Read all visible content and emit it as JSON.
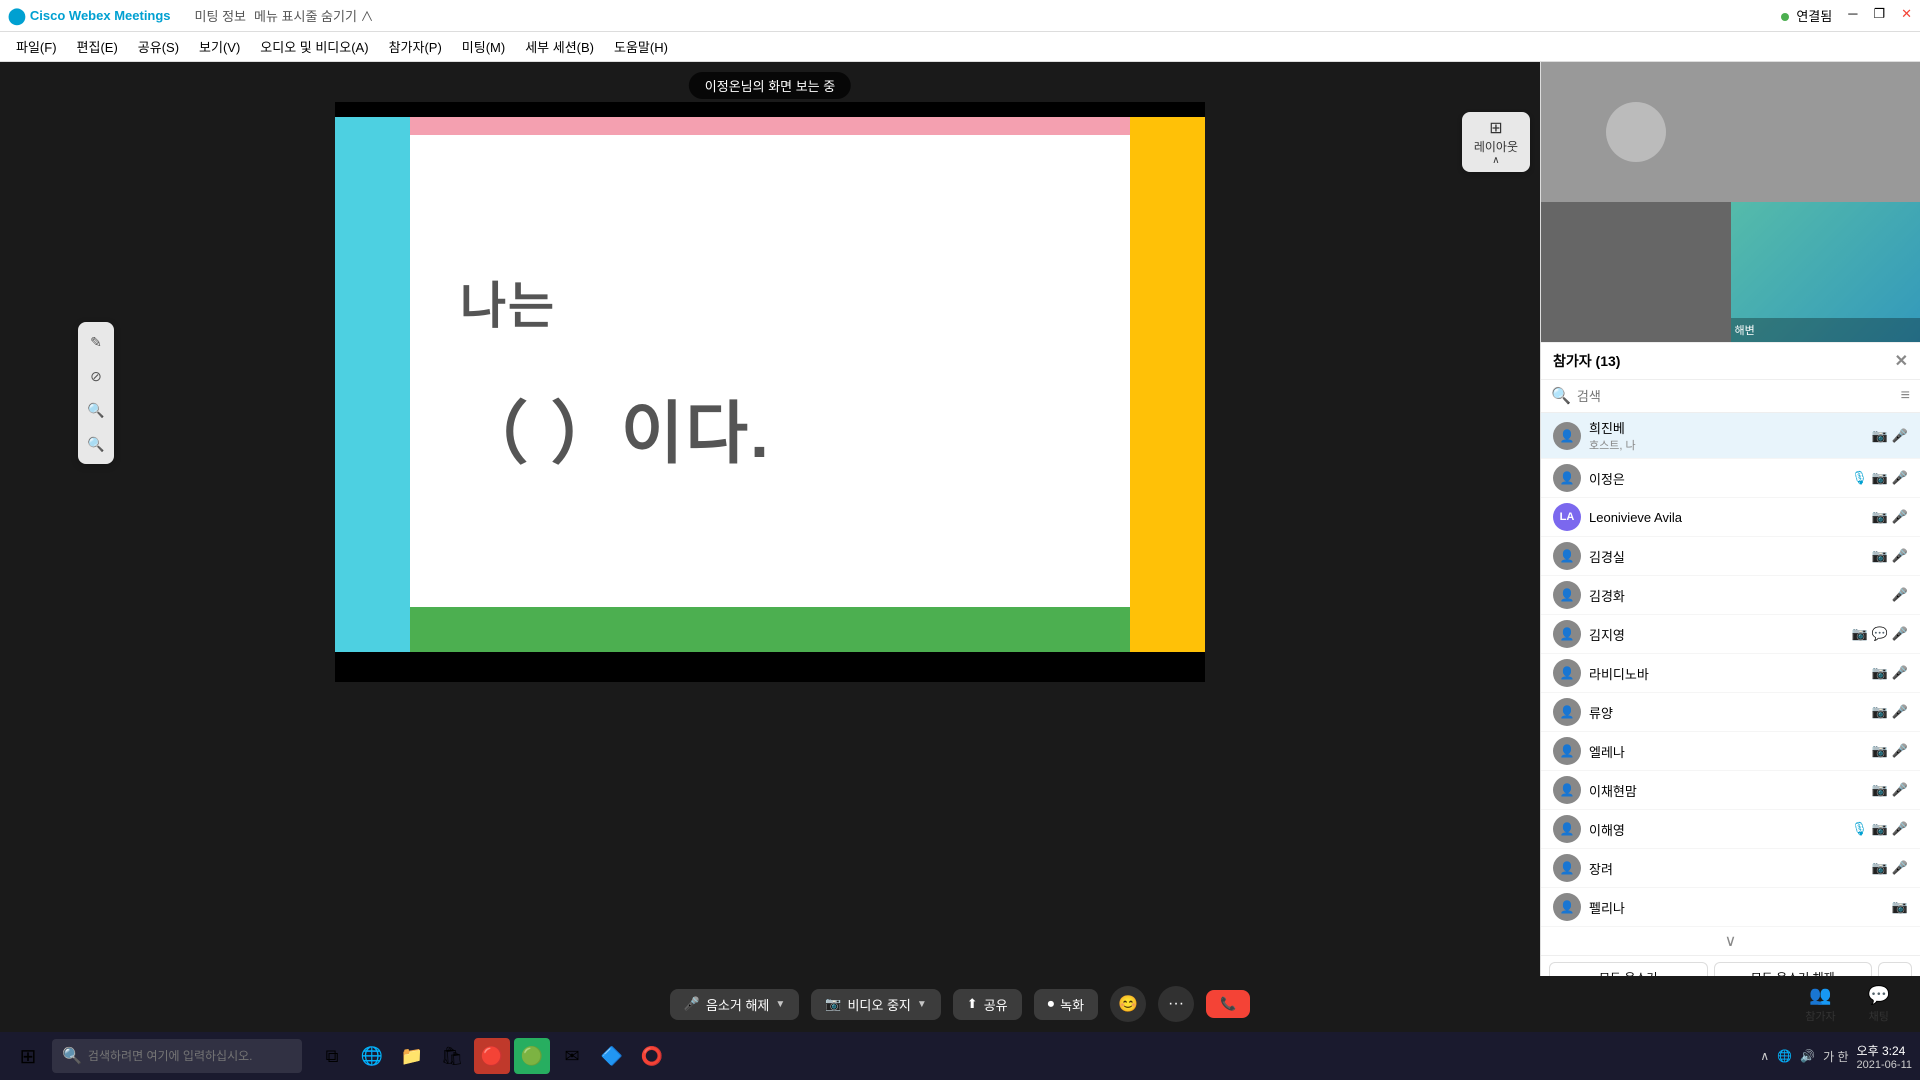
{
  "titlebar": {
    "app_name": "Cisco Webex Meetings",
    "meeting_info": "미팅 정보",
    "hide_menu": "메뉴 표시줄 숨기기 ∧",
    "connected": "연결됨",
    "minimize": "─",
    "restore": "❐",
    "close": "✕"
  },
  "menubar": {
    "items": [
      "파일(F)",
      "편집(E)",
      "공유(S)",
      "보기(V)",
      "오디오 및 비디오(A)",
      "참가자(P)",
      "미팅(M)",
      "세부 세션(B)",
      "도움말(H)"
    ]
  },
  "presentation": {
    "screen_share_label": "이정온님의 화면 보는 중",
    "layout_btn": "레이아웃",
    "slide_text_line1": "나는",
    "slide_text_line2": "（                    ）이다."
  },
  "annotation_tools": {
    "tools": [
      "✎",
      "⊘",
      "🔍",
      "🔍"
    ]
  },
  "participants": {
    "header": "참가자 (13)",
    "search_placeholder": "검색",
    "list": [
      {
        "name": "희진베",
        "sub": "호스트, 나",
        "avatar": "👤",
        "avatar_color": "#888",
        "has_video": true,
        "mic": "muted",
        "highlighted": true
      },
      {
        "name": "이정은",
        "sub": "",
        "avatar": "👤",
        "avatar_color": "#888",
        "has_mic_indicator": true,
        "has_video": true,
        "mic": "on"
      },
      {
        "name": "Leonivieve Avila",
        "sub": "",
        "avatar": "LA",
        "avatar_color": "#7b68ee",
        "has_video": true,
        "mic": "muted"
      },
      {
        "name": "김경실",
        "sub": "",
        "avatar": "👤",
        "avatar_color": "#888",
        "has_video": true,
        "mic": "green"
      },
      {
        "name": "김경화",
        "sub": "",
        "avatar": "👤",
        "avatar_color": "#888",
        "has_video": false,
        "mic": "muted"
      },
      {
        "name": "김지영",
        "sub": "",
        "avatar": "👤",
        "avatar_color": "#888",
        "has_video": true,
        "mic": "muted"
      },
      {
        "name": "라비디노바",
        "sub": "",
        "avatar": "👤",
        "avatar_color": "#888",
        "has_video": true,
        "mic": "muted"
      },
      {
        "name": "류양",
        "sub": "",
        "avatar": "👤",
        "avatar_color": "#888",
        "has_video": true,
        "mic": "muted"
      },
      {
        "name": "엘레나",
        "sub": "",
        "avatar": "👤",
        "avatar_color": "#888",
        "has_video": true,
        "mic": "muted"
      },
      {
        "name": "이채현맘",
        "sub": "",
        "avatar": "👤",
        "avatar_color": "#888",
        "has_video": true,
        "mic": "muted"
      },
      {
        "name": "이해영",
        "sub": "",
        "avatar": "👤",
        "avatar_color": "#888",
        "has_video": true,
        "has_mic_indicator": true,
        "mic": "muted"
      },
      {
        "name": "장려",
        "sub": "",
        "avatar": "👤",
        "avatar_color": "#888",
        "has_video": true,
        "mic": "muted"
      },
      {
        "name": "펠리나",
        "sub": "",
        "avatar": "👤",
        "avatar_color": "#888",
        "has_video": true,
        "mic": ""
      }
    ],
    "btn_mute_all": "모두 음소거",
    "btn_unmute_all": "모두 음소거 해제",
    "btn_more": "···"
  },
  "bottom_toolbar": {
    "mic_btn": "음소거 해제",
    "video_btn": "비디오 중지",
    "share_btn": "공유",
    "record_btn": "녹화",
    "emoji_btn": "😊",
    "more_btn": "···",
    "participants_tab": "참가자",
    "chat_tab": "채팅"
  },
  "taskbar": {
    "search_placeholder": "검색하려면 여기에 입력하십시오.",
    "time": "오후 3:24",
    "date": "2021-06-11",
    "indicator": "가  한"
  },
  "colors": {
    "accent": "#00a0d1",
    "slide_pink": "#f4a0b0",
    "slide_cyan": "#4dd0e1",
    "slide_yellow": "#ffc107",
    "slide_green": "#4caf50",
    "mic_on": "#00a0d1",
    "mic_muted": "#f44336"
  }
}
